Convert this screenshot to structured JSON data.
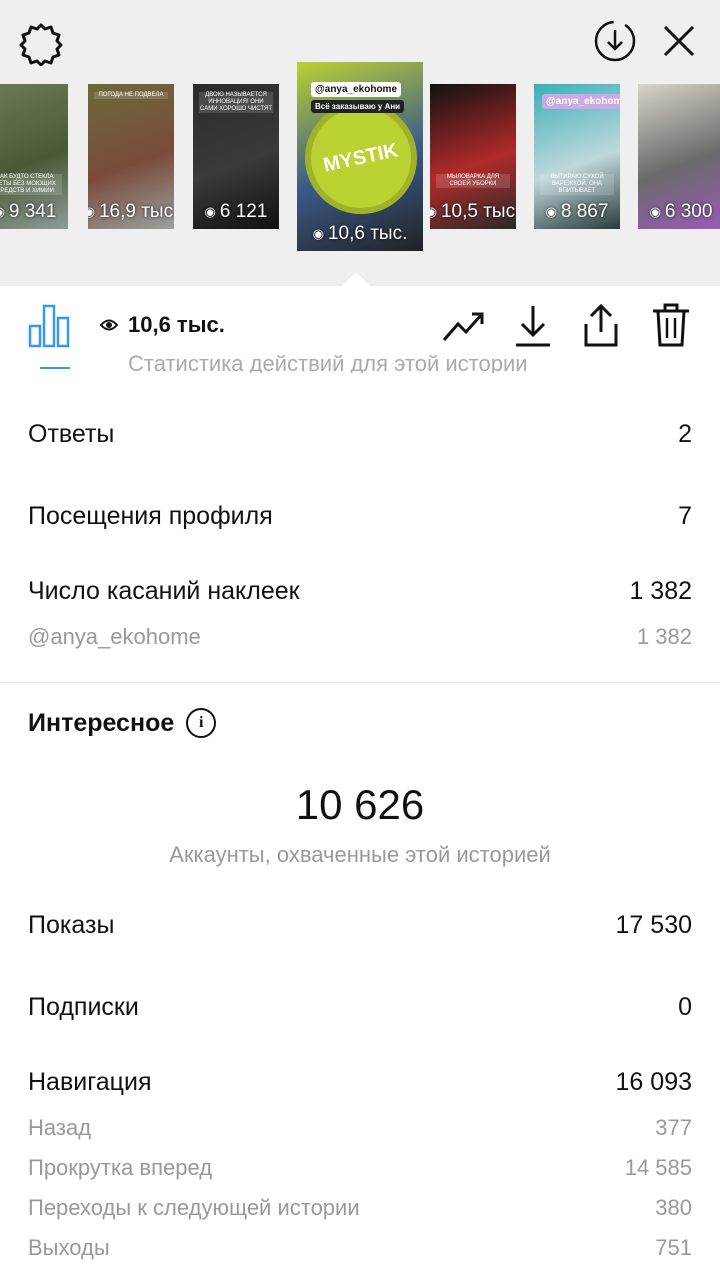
{
  "top_icons": {
    "settings": "gear-icon",
    "download_circle": "download-circle-icon",
    "close": "close-icon"
  },
  "stories": [
    {
      "views": "9 341",
      "caption": "КАК БУДТО СТЕКЛА НЕТЫ БЕЗ МОЮЩИХ СРЕДСТВ И ХИМИИ",
      "colors": [
        "#6f7a58",
        "#4a5a36",
        "#8f9a9a"
      ]
    },
    {
      "views": "16,9 тыс.",
      "caption": "ПОГОДА НЕ ПОДВЕЛА",
      "colors": [
        "#6b6a3a",
        "#7a4b3a",
        "#9aa0a0"
      ]
    },
    {
      "views": "6 121",
      "caption": "ДВОЮ НАЗЫВАЕТСЯ ИННОВАЦИЯ! ОНИ САМИ ХОРОШО ЧИСТЯТ",
      "colors": [
        "#2a2a2a",
        "#3a3a3a",
        "#111"
      ]
    },
    {
      "views": "10,6 тыс.",
      "tag": "@anya_ekohome",
      "tag2": "Всё заказываю у Ани",
      "brand": "MYSTIK",
      "colors": [
        "#bcd132",
        "#3a5a8a",
        "#222"
      ]
    },
    {
      "views": "10,5 тыс.",
      "caption": "МЫЛОВАРКА ДЛЯ СВОЕЙ УБОРКИ",
      "colors": [
        "#111",
        "#b02a2a",
        "#2a2a2a"
      ]
    },
    {
      "views": "8 867",
      "tag": "@anya_ekohome",
      "caption": "ВЫТИРАЮ СУХОЙ ВАРЕЖКОЙ, ОНА ВПИТЫВАЕТ",
      "colors": [
        "#3ab0b8",
        "#bfd8dc",
        "#2a3a3a"
      ]
    },
    {
      "views": "6 300",
      "colors": [
        "#d8d4c8",
        "#6a6a6a",
        "#9a5ab8"
      ]
    }
  ],
  "toolbar": {
    "views": "10,6 тыс.",
    "icons": [
      "bar-chart-icon",
      "eye-icon",
      "trending-icon",
      "download-icon",
      "share-icon",
      "trash-icon"
    ],
    "partial_label": "Статистика действий для этой истории"
  },
  "actions": [
    {
      "label": "Ответы",
      "value": "2"
    },
    {
      "label": "Посещения профиля",
      "value": "7"
    },
    {
      "label": "Число касаний наклеек",
      "value": "1 382"
    }
  ],
  "sticker_sub": {
    "label": "@anya_ekohome",
    "value": "1 382"
  },
  "discovery": {
    "title": "Интересное",
    "reach_value": "10 626",
    "reach_caption": "Аккаунты, охваченные этой историей",
    "rows": [
      {
        "label": "Показы",
        "value": "17 530"
      },
      {
        "label": "Подписки",
        "value": "0"
      },
      {
        "label": "Навигация",
        "value": "16 093"
      }
    ],
    "nav_sub": [
      {
        "label": "Назад",
        "value": "377"
      },
      {
        "label": "Прокрутка вперед",
        "value": "14 585"
      },
      {
        "label": "Переходы к следующей истории",
        "value": "380"
      },
      {
        "label": "Выходы",
        "value": "751"
      }
    ]
  },
  "colors": {
    "accent": "#3897f0",
    "muted": "#999999",
    "divider": "#e2e2e2",
    "top_bg": "#efefef"
  }
}
